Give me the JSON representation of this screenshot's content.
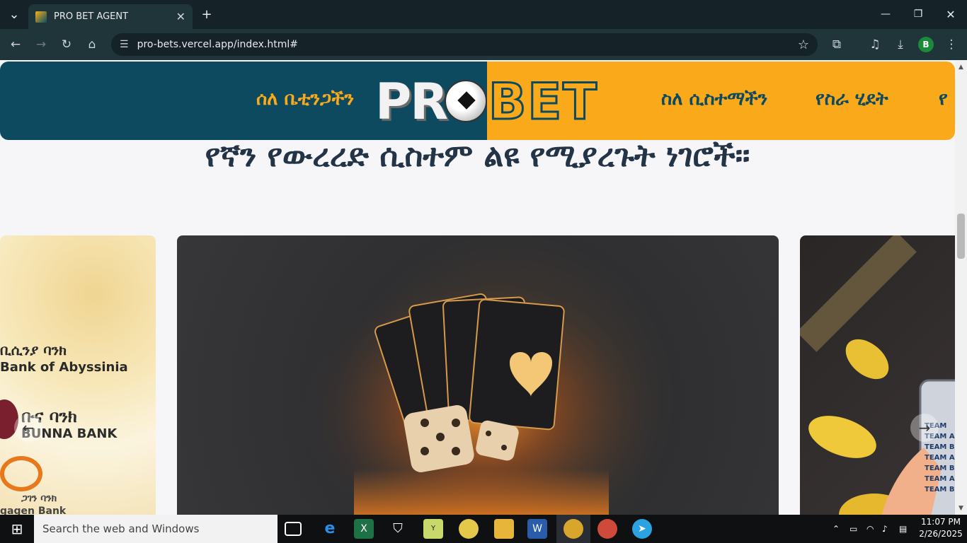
{
  "browser": {
    "tab_title": "PRO BET AGENT",
    "tab_close": "✕",
    "new_tab": "+",
    "url": "pro-bets.vercel.app/index.html#",
    "profile_initial": "B",
    "window_controls": {
      "minimize": "—",
      "restore": "❐",
      "close": "✕"
    }
  },
  "header": {
    "nav_left": "ሰለ ቤቲንጋችን",
    "logo_pr": "PR",
    "logo_bet": "BET",
    "nav_right": [
      "ስለ ሲስተማችን",
      "የስራ ሂደት",
      "የ"
    ]
  },
  "main": {
    "section_title": "የኛን የውረረድ ሲስተም ልዩ የሚያረጉት ነገሮች።",
    "left_card": {
      "bank1_am": "ቢሲንያ ባንክ",
      "bank1_en": "Bank of Abyssinia",
      "bank2_am": "ቡና ባንክ",
      "bank2_en": "BUNNA BANK",
      "bank3_am": "ጋገን ባንክ",
      "bank3_en": "gagen Bank"
    },
    "right_card": {
      "team_labels": [
        "TEAM",
        "TEAM A",
        "TEAM B",
        "TEAM A",
        "TEAM B",
        "TEAM A",
        "TEAM B"
      ]
    },
    "prev_arrow": "←",
    "next_arrow": "→"
  },
  "taskbar": {
    "search_placeholder": "Search the web and Windows",
    "time": "11:07 PM",
    "date": "2/26/2025"
  }
}
